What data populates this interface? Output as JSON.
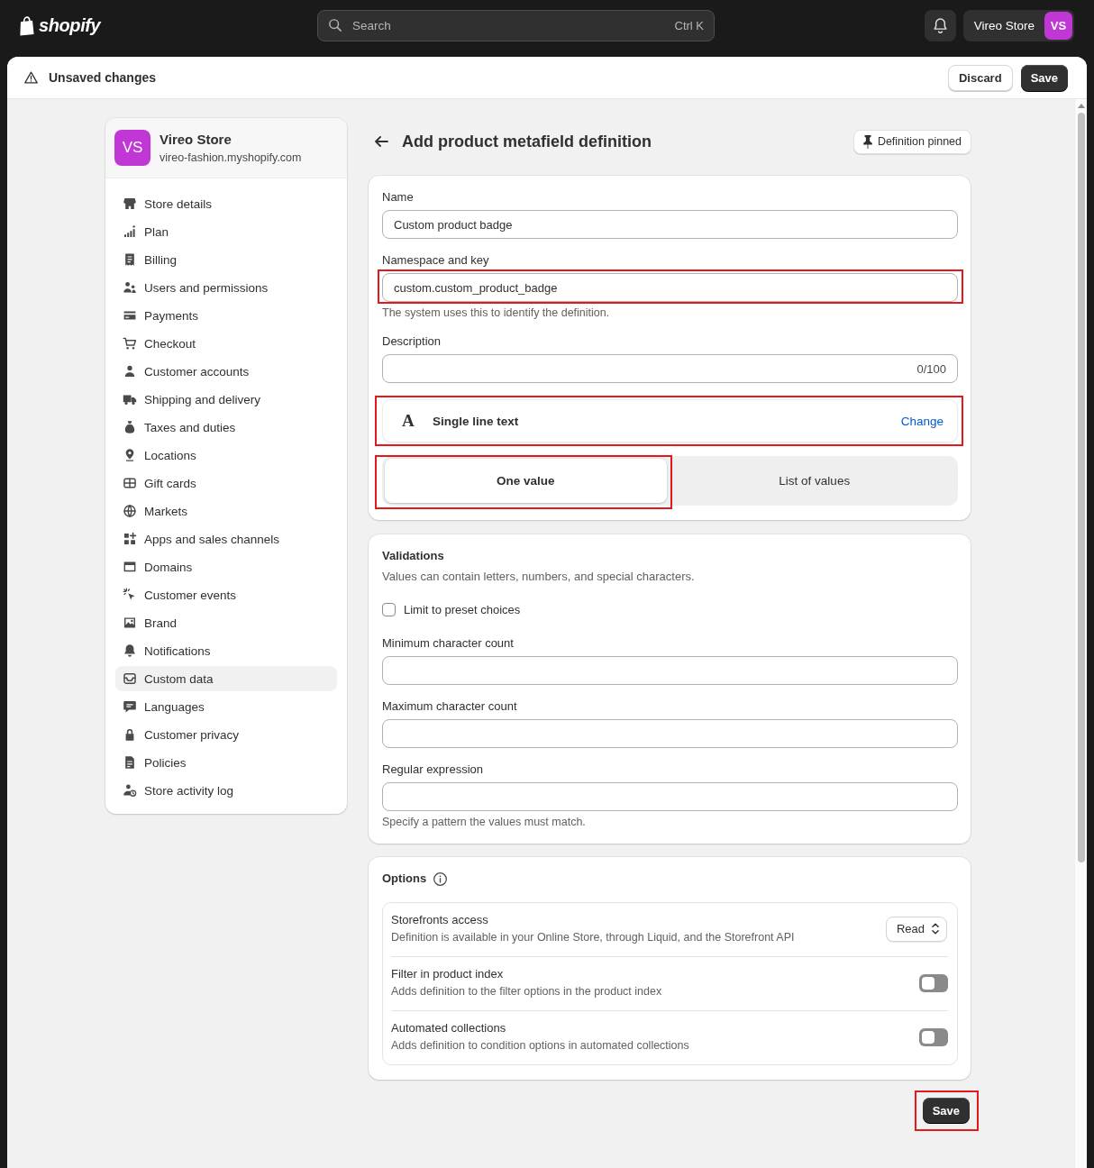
{
  "top_bar": {
    "logo": "shopify",
    "search": {
      "placeholder": "Search",
      "shortcut": "Ctrl K"
    },
    "store": {
      "name": "Vireo Store",
      "initials": "VS"
    }
  },
  "save_bar": {
    "message": "Unsaved changes",
    "buttons": [
      {
        "label": "Discard",
        "kind": "secondary"
      },
      {
        "label": "Save",
        "kind": "primary"
      }
    ]
  },
  "sidebar": {
    "store": {
      "initials": "VS",
      "name": "Vireo Store",
      "domain": "vireo-fashion.myshopify.com"
    },
    "items": [
      {
        "label": "Store details",
        "selected": false
      },
      {
        "label": "Plan",
        "selected": false
      },
      {
        "label": "Billing",
        "selected": false
      },
      {
        "label": "Users and permissions",
        "selected": false
      },
      {
        "label": "Payments",
        "selected": false
      },
      {
        "label": "Checkout",
        "selected": false
      },
      {
        "label": "Customer accounts",
        "selected": false
      },
      {
        "label": "Shipping and delivery",
        "selected": false
      },
      {
        "label": "Taxes and duties",
        "selected": false
      },
      {
        "label": "Locations",
        "selected": false
      },
      {
        "label": "Gift cards",
        "selected": false
      },
      {
        "label": "Markets",
        "selected": false
      },
      {
        "label": "Apps and sales channels",
        "selected": false
      },
      {
        "label": "Domains",
        "selected": false
      },
      {
        "label": "Customer events",
        "selected": false
      },
      {
        "label": "Brand",
        "selected": false
      },
      {
        "label": "Notifications",
        "selected": false
      },
      {
        "label": "Custom data",
        "selected": true
      },
      {
        "label": "Languages",
        "selected": false
      },
      {
        "label": "Customer privacy",
        "selected": false
      },
      {
        "label": "Policies",
        "selected": false
      },
      {
        "label": "Store activity log",
        "selected": false
      }
    ]
  },
  "page": {
    "title": "Add product metafield definition",
    "pin_button": "Definition pinned"
  },
  "definition": {
    "fields": [
      {
        "label": "Name",
        "value": "Custom product badge",
        "highlighted": false
      },
      {
        "label": "Namespace and key",
        "value": "custom.custom_product_badge",
        "help": "The system uses this to identify the definition.",
        "highlighted": true
      },
      {
        "label": "Description",
        "counter": "0/100",
        "highlighted": false
      }
    ],
    "type": {
      "glyph": "A",
      "label": "Single line text",
      "action": "Change",
      "highlighted": true
    },
    "value_options": [
      {
        "label": "One value",
        "selected": true,
        "highlighted": true
      },
      {
        "label": "List of values",
        "selected": false,
        "highlighted": false
      }
    ]
  },
  "validations": {
    "title": "Validations",
    "description": "Values can contain letters, numbers, and special characters.",
    "preset_choices": {
      "label": "Limit to preset choices",
      "checked": false
    },
    "fields": [
      {
        "label": "Minimum character count"
      },
      {
        "label": "Maximum character count"
      },
      {
        "label": "Regular expression",
        "help": "Specify a pattern the values must match."
      }
    ]
  },
  "options": {
    "title": "Options",
    "rows": [
      {
        "kind": "select",
        "title": "Storefronts access",
        "description": "Definition is available in your Online Store, through Liquid, and the Storefront API",
        "value": "Read"
      },
      {
        "kind": "toggle",
        "title": "Filter in product index",
        "description": "Adds definition to the filter options in the product index",
        "on": false
      },
      {
        "kind": "toggle",
        "title": "Automated collections",
        "description": "Adds definition to condition options in automated collections",
        "on": false
      }
    ]
  },
  "footer": {
    "save": {
      "label": "Save",
      "highlighted": true
    }
  }
}
